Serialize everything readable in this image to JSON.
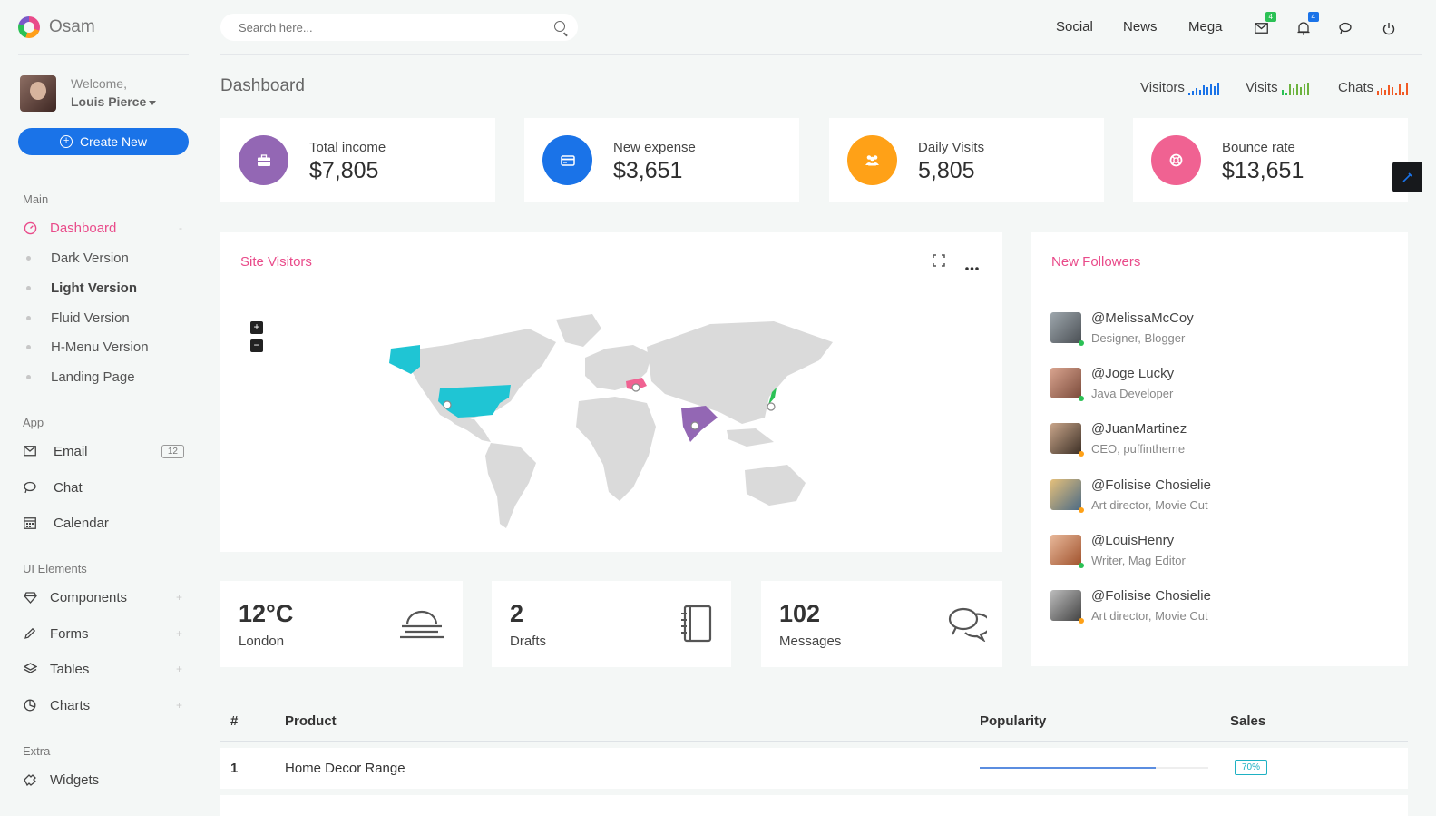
{
  "brand": "Osam",
  "profile": {
    "welcome": "Welcome,",
    "name": "Louis Pierce"
  },
  "create_button": "Create New",
  "sidebar": {
    "main_title": "Main",
    "dashboard": "Dashboard",
    "sub_items": [
      "Dark Version",
      "Light Version",
      "Fluid Version",
      "H-Menu Version",
      "Landing Page"
    ],
    "app_title": "App",
    "email": "Email",
    "email_count": "12",
    "chat": "Chat",
    "calendar": "Calendar",
    "ui_title": "UI Elements",
    "components": "Components",
    "forms": "Forms",
    "tables": "Tables",
    "charts": "Charts",
    "extra_title": "Extra",
    "widgets": "Widgets"
  },
  "search": {
    "placeholder": "Search here..."
  },
  "topnav": {
    "social": "Social",
    "news": "News",
    "mega": "Mega",
    "mail_badge": "4",
    "bell_badge": "4"
  },
  "page_title": "Dashboard",
  "mini_stats": {
    "visitors": "Visitors",
    "visits": "Visits",
    "chats": "Chats"
  },
  "stats": [
    {
      "label": "Total income",
      "value": "$7,805",
      "color": "#9367b4",
      "icon": "briefcase-icon"
    },
    {
      "label": "New expense",
      "value": "$3,651",
      "color": "#1a73e8",
      "icon": "credit-card-icon"
    },
    {
      "label": "Daily Visits",
      "value": "5,805",
      "color": "#ffa117",
      "icon": "users-icon"
    },
    {
      "label": "Bounce rate",
      "value": "$13,651",
      "color": "#f06292",
      "icon": "life-ring-icon"
    }
  ],
  "site_visitors": {
    "title": "Site Visitors",
    "zoom_in": "+",
    "zoom_out": "−"
  },
  "followers": {
    "title": "New Followers",
    "list": [
      {
        "handle": "@MelissaMcCoy",
        "role": "Designer, Blogger",
        "status": "#2bc155"
      },
      {
        "handle": "@Joge Lucky",
        "role": "Java Developer",
        "status": "#2bc155"
      },
      {
        "handle": "@JuanMartinez",
        "role": "CEO, puffintheme",
        "status": "#ffa117"
      },
      {
        "handle": "@Folisise Chosielie",
        "role": "Art director, Movie Cut",
        "status": "#ffa117"
      },
      {
        "handle": "@LouisHenry",
        "role": "Writer, Mag Editor",
        "status": "#2bc155"
      },
      {
        "handle": "@Folisise Chosielie",
        "role": "Art director, Movie Cut",
        "status": "#ffa117"
      }
    ]
  },
  "weather": {
    "value": "12°C",
    "label": "London"
  },
  "drafts": {
    "value": "2",
    "label": "Drafts"
  },
  "messages": {
    "value": "102",
    "label": "Messages"
  },
  "table": {
    "headers": {
      "num": "#",
      "product": "Product",
      "popularity": "Popularity",
      "sales": "Sales"
    },
    "rows": [
      {
        "num": "1",
        "product": "Home Decor Range",
        "popularity": 0.77,
        "sales": "70%"
      }
    ]
  }
}
